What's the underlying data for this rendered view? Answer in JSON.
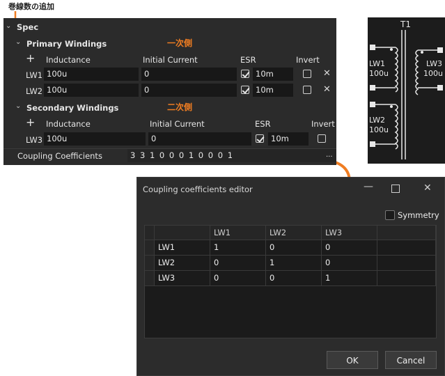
{
  "annotations": {
    "add_winding": "巻線数の追加",
    "primary": "一次側",
    "secondary": "二次側"
  },
  "spec": {
    "title": "Spec",
    "primary": {
      "title": "Primary Windings",
      "columns": {
        "inductance": "Inductance",
        "initial_current": "Initial Current",
        "esr": "ESR",
        "invert": "Invert"
      },
      "rows": [
        {
          "name": "LW1",
          "inductance": "100u",
          "initial_current": "0",
          "esr_enabled": true,
          "esr": "10m",
          "invert": false
        },
        {
          "name": "LW2",
          "inductance": "100u",
          "initial_current": "0",
          "esr_enabled": true,
          "esr": "10m",
          "invert": false
        }
      ]
    },
    "secondary": {
      "title": "Secondary Windings",
      "columns": {
        "inductance": "Inductance",
        "initial_current": "Initial Current",
        "esr": "ESR",
        "invert": "Invert"
      },
      "rows": [
        {
          "name": "LW3",
          "inductance": "100u",
          "initial_current": "0",
          "esr_enabled": true,
          "esr": "10m",
          "invert": false
        }
      ]
    },
    "coupling": {
      "label": "Coupling Coefficients",
      "value": "3 3 1 0 0 0 1 0 0 0 1",
      "more": "..."
    }
  },
  "schematic": {
    "title": "T1",
    "windings": [
      {
        "name": "LW1",
        "value": "100u"
      },
      {
        "name": "LW3",
        "value": "100u"
      },
      {
        "name": "LW2",
        "value": "100u"
      }
    ]
  },
  "dialog": {
    "title": "Coupling coefficients editor",
    "symmetry_label": "Symmetry",
    "columns": [
      "LW1",
      "LW2",
      "LW3"
    ],
    "rows": [
      {
        "name": "LW1",
        "values": [
          "1",
          "0",
          "0"
        ]
      },
      {
        "name": "LW2",
        "values": [
          "0",
          "1",
          "0"
        ]
      },
      {
        "name": "LW3",
        "values": [
          "0",
          "0",
          "1"
        ]
      }
    ],
    "ok_label": "OK",
    "cancel_label": "Cancel"
  },
  "colors": {
    "accent": "#ef7d22",
    "panel": "#2b2b2b",
    "field": "#181818"
  }
}
